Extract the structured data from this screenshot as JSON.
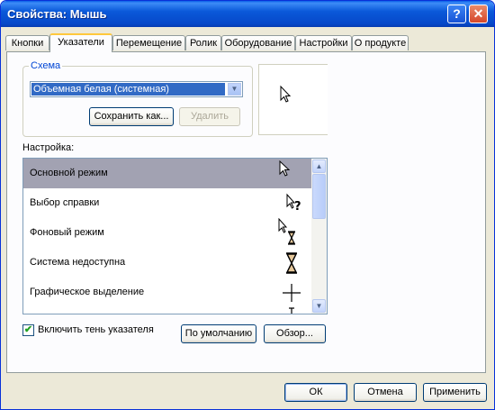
{
  "window": {
    "title": "Свойства: Мышь",
    "help_glyph": "?",
    "close_glyph": "✕"
  },
  "tabs": [
    {
      "label": "Кнопки"
    },
    {
      "label": "Указатели"
    },
    {
      "label": "Перемещение"
    },
    {
      "label": "Ролик"
    },
    {
      "label": "Оборудование"
    },
    {
      "label": "Настройки"
    },
    {
      "label": "О продукте"
    }
  ],
  "active_tab": "Указатели",
  "scheme": {
    "legend": "Схема",
    "selected": "Объемная белая (системная)",
    "save_as_label": "Сохранить как...",
    "delete_label": "Удалить"
  },
  "settings_label": "Настройка:",
  "cursor_list": [
    {
      "label": "Основной режим",
      "icon": "arrow-cursor-icon",
      "selected": true
    },
    {
      "label": "Выбор справки",
      "icon": "help-select-cursor-icon",
      "selected": false
    },
    {
      "label": "Фоновый режим",
      "icon": "working-in-background-cursor-icon",
      "selected": false
    },
    {
      "label": "Система недоступна",
      "icon": "hourglass-cursor-icon",
      "selected": false
    },
    {
      "label": "Графическое выделение",
      "icon": "crosshair-cursor-icon",
      "selected": false
    },
    {
      "label": "",
      "icon": "text-select-cursor-icon",
      "selected": false
    }
  ],
  "shadow": {
    "label": "Включить тень указателя",
    "checked": true
  },
  "defaults_label": "По умолчанию",
  "browse_label": "Обзор...",
  "footer": {
    "ok_label": "ОК",
    "cancel_label": "Отмена",
    "apply_label": "Применить"
  }
}
